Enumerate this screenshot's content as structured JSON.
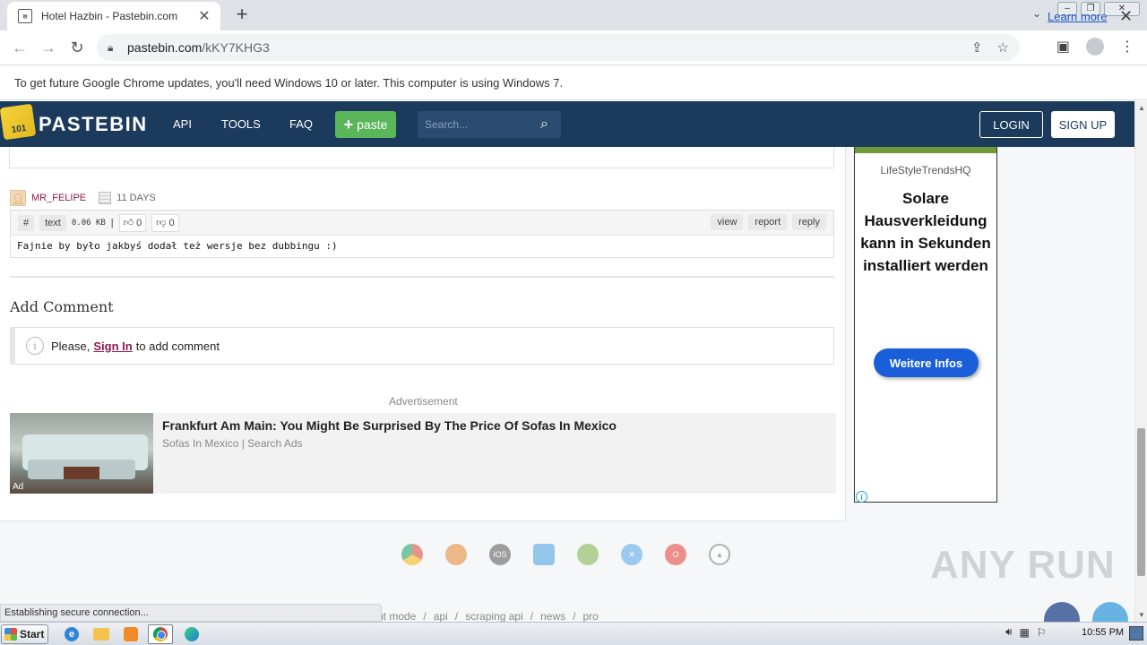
{
  "browser": {
    "tab_title": "Hotel Hazbin - Pastebin.com",
    "new_tab": "+",
    "url_host": "pastebin.com",
    "url_path": "/kKY7KHG3",
    "infobar_text": "To get future Google Chrome updates, you'll need Windows 10 or later. This computer is using Windows 7.",
    "infobar_link": "Learn more"
  },
  "pastebin_header": {
    "brand": "PASTEBIN",
    "logo_text": "101",
    "nav": [
      "API",
      "TOOLS",
      "FAQ"
    ],
    "paste_button": "paste",
    "search_placeholder": "Search...",
    "login": "LOGIN",
    "signup": "SIGN UP"
  },
  "comment": {
    "username": "MR_FELIPE",
    "age": "11 DAYS",
    "hash": "#",
    "syntax": "text",
    "size": "0.06 KB",
    "separator": "|",
    "likes": "0",
    "dislikes": "0",
    "actions": [
      "view",
      "report",
      "reply"
    ],
    "body": "Fajnie by było jakbyś dodał też wersje bez dubbingu :)"
  },
  "add_comment": {
    "title": "Add Comment",
    "prefix": "Please,",
    "sign_in": "Sign In",
    "suffix": "to add comment"
  },
  "ad": {
    "label": "Advertisement",
    "badge": "Ad",
    "title": "Frankfurt Am Main: You Might Be Surprised By The Price Of Sofas In Mexico",
    "source": "Sofas In Mexico | Search Ads"
  },
  "side_ad": {
    "brand": "LifeStyleTrendsHQ",
    "headline": "Solare Hausverkleidung kann in Sekunden installiert werden",
    "button": "Weitere Infos"
  },
  "footer": {
    "icons": [
      "chrome-icon",
      "firefox-icon",
      "ios-icon",
      "windows-icon",
      "android-icon",
      "mac-icon",
      "opera-icon",
      "linux-icon"
    ],
    "ios_text": "iOS",
    "links_visible": [
      "nt mode",
      "/",
      "api",
      "/",
      "scraping api",
      "/",
      "news",
      "/",
      "pro"
    ],
    "watermark": "ANY RUN"
  },
  "status_text": "Establishing secure connection...",
  "taskbar": {
    "start": "Start",
    "clock": "10:55 PM"
  },
  "colors": {
    "pastebin_header": "#1b3a5c",
    "paste_button": "#5bb659",
    "username": "#8c1a4b",
    "side_ad_button": "#1a5fd9"
  }
}
